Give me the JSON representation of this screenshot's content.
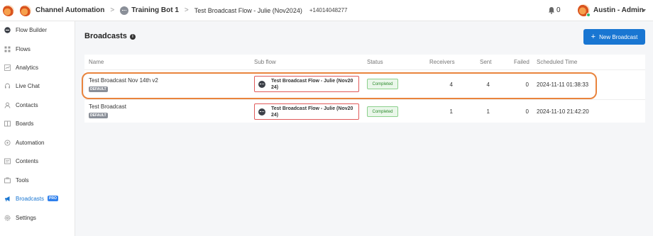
{
  "topbar": {
    "workspace": "Channel Automation",
    "bot": "Training Bot 1",
    "flow": "Test Broadcast Flow - Julie (Nov2024)",
    "phone": "+14014048277",
    "notifications": "0",
    "user": "Austin - Admin"
  },
  "sidebar": {
    "items": [
      {
        "label": "Flow Builder",
        "icon": "chat-bubble-icon"
      },
      {
        "label": "Flows",
        "icon": "grid-icon"
      },
      {
        "label": "Analytics",
        "icon": "chart-icon"
      },
      {
        "label": "Live Chat",
        "icon": "headset-icon"
      },
      {
        "label": "Contacts",
        "icon": "person-icon"
      },
      {
        "label": "Boards",
        "icon": "board-icon"
      },
      {
        "label": "Automation",
        "icon": "automation-icon"
      },
      {
        "label": "Contents",
        "icon": "contents-icon"
      },
      {
        "label": "Tools",
        "icon": "tools-icon"
      },
      {
        "label": "Broadcasts",
        "icon": "megaphone-icon",
        "badge": "PRO"
      },
      {
        "label": "Settings",
        "icon": "gear-icon"
      }
    ]
  },
  "main": {
    "title": "Broadcasts",
    "new_button": "New Broadcast",
    "columns": [
      "Name",
      "Sub flow",
      "Status",
      "Receivers",
      "Sent",
      "Failed",
      "Scheduled Time"
    ],
    "rows": [
      {
        "name": "Test Broadcast Nov 14th v2",
        "badge": "DEFAULT",
        "subflow_line1": "Test Broadcast Flow - Julie (Nov20",
        "subflow_line2": "24)",
        "status": "Completed",
        "receivers": "4",
        "sent": "4",
        "failed": "0",
        "scheduled": "2024-11-11 01:38:33"
      },
      {
        "name": "Test Broadcast",
        "badge": "DEFAULT",
        "subflow_line1": "Test Broadcast Flow - Julie (Nov20",
        "subflow_line2": "24)",
        "status": "Completed",
        "receivers": "1",
        "sent": "1",
        "failed": "0",
        "scheduled": "2024-11-10 21:42:20"
      }
    ]
  },
  "colors": {
    "accent": "#1976d2",
    "highlight": "#e9843d",
    "subflow_border": "#e05a5a",
    "status_green": "#2e8b2e"
  }
}
